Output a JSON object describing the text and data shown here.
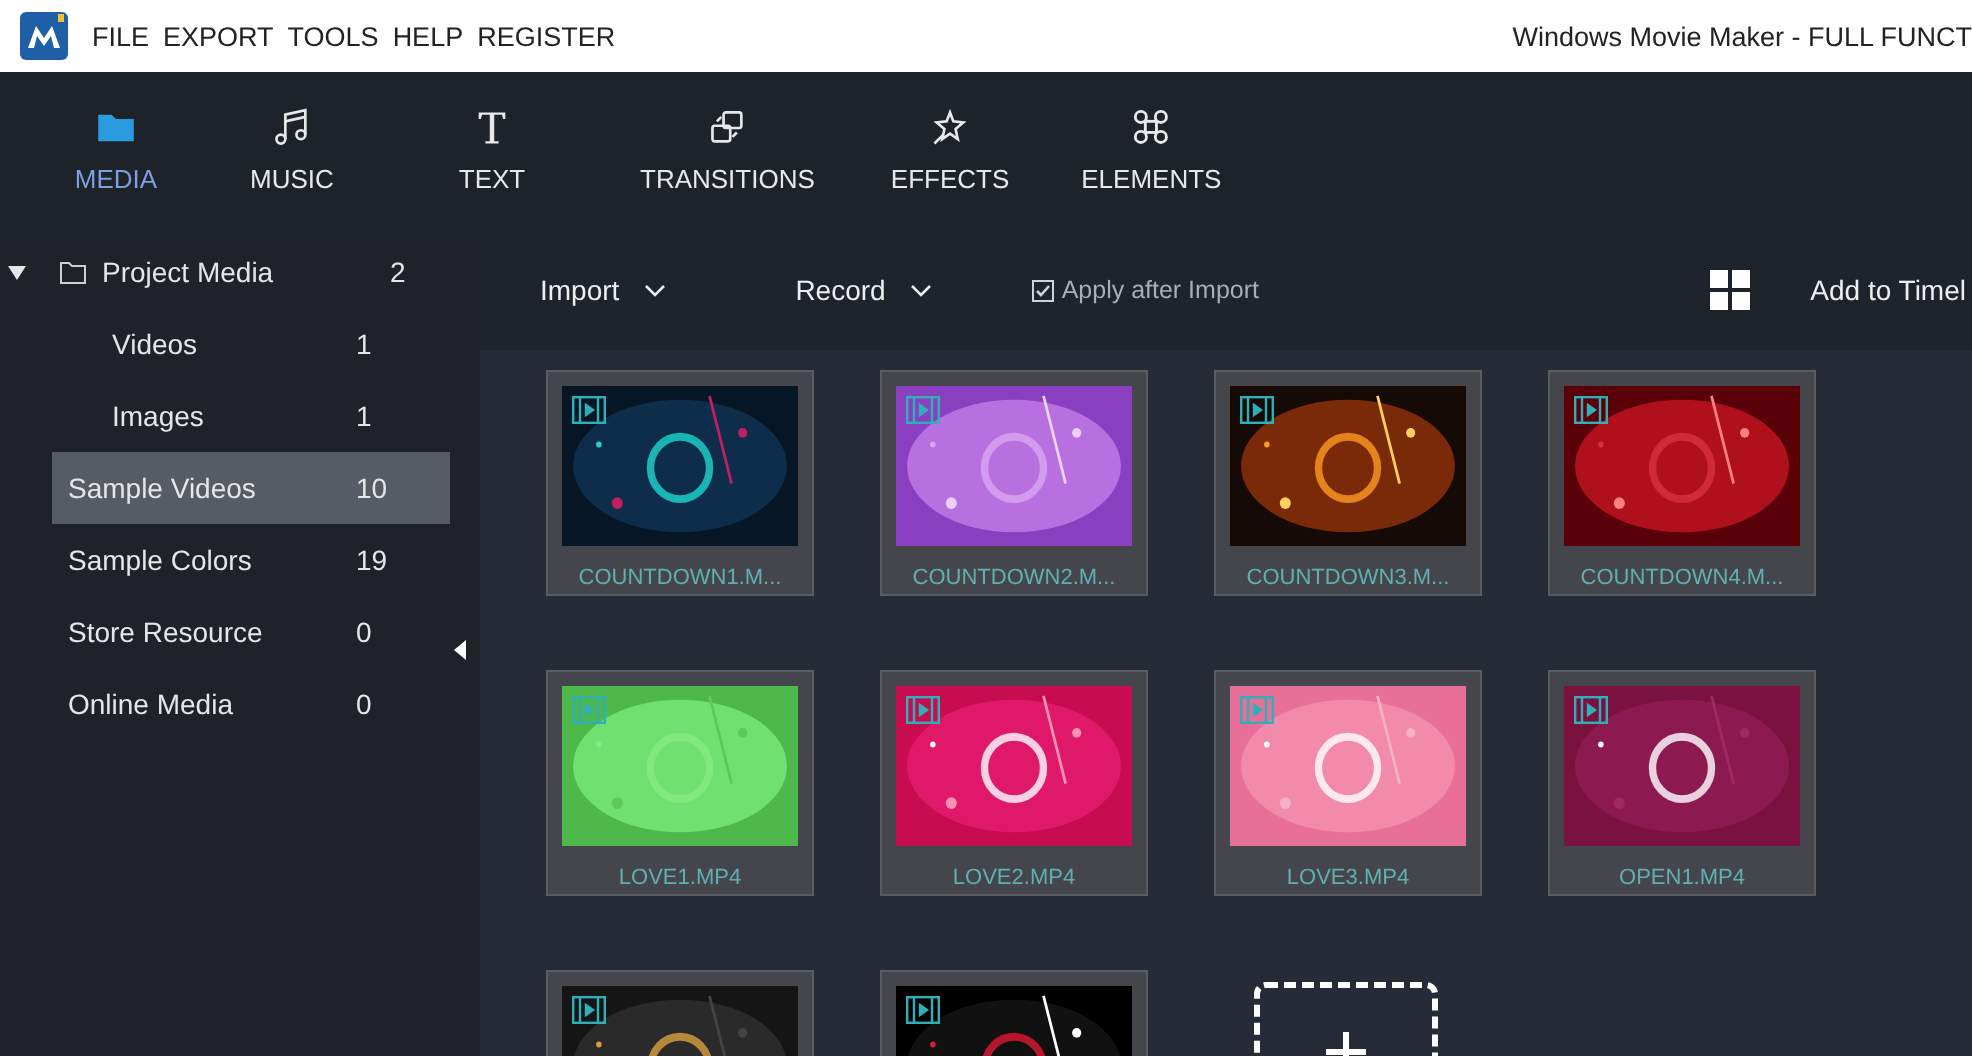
{
  "menu_bar": {
    "items": [
      "FILE",
      "EXPORT",
      "TOOLS",
      "HELP",
      "REGISTER"
    ],
    "window_title": "Windows Movie Maker - FULL FUNCT"
  },
  "tabs": [
    {
      "label": "MEDIA",
      "selected": true
    },
    {
      "label": "MUSIC",
      "selected": false
    },
    {
      "label": "TEXT",
      "selected": false
    },
    {
      "label": "TRANSITIONS",
      "selected": false
    },
    {
      "label": "EFFECTS",
      "selected": false
    },
    {
      "label": "ELEMENTS",
      "selected": false
    }
  ],
  "sidebar": {
    "items": [
      {
        "label": "Project Media",
        "count": "2",
        "selected": false,
        "expanded": true,
        "children": [
          {
            "label": "Videos",
            "count": "1",
            "selected": false
          },
          {
            "label": "Images",
            "count": "1",
            "selected": false
          }
        ]
      },
      {
        "label": "Sample Videos",
        "count": "10",
        "selected": true
      },
      {
        "label": "Sample Colors",
        "count": "19",
        "selected": false
      },
      {
        "label": "Store Resource",
        "count": "0",
        "selected": false
      },
      {
        "label": "Online Media",
        "count": "0",
        "selected": false
      }
    ]
  },
  "media_toolbar": {
    "import": "Import",
    "record": "Record",
    "apply_after_import": {
      "label": "Apply after Import",
      "checked": true
    },
    "add_to_timeline": "Add to Timel"
  },
  "media": [
    {
      "kind": "video",
      "name": "COUNTDOWN1.M..."
    },
    {
      "kind": "video",
      "name": "COUNTDOWN2.M..."
    },
    {
      "kind": "video",
      "name": "COUNTDOWN3.M..."
    },
    {
      "kind": "video",
      "name": "COUNTDOWN4.M..."
    },
    {
      "kind": "video",
      "name": "LOVE1.MP4"
    },
    {
      "kind": "video",
      "name": "LOVE2.MP4"
    },
    {
      "kind": "video",
      "name": "LOVE3.MP4"
    },
    {
      "kind": "video",
      "name": "OPEN1.MP4"
    },
    {
      "kind": "video"
    },
    {
      "kind": "video"
    },
    {
      "kind": "add"
    }
  ]
}
